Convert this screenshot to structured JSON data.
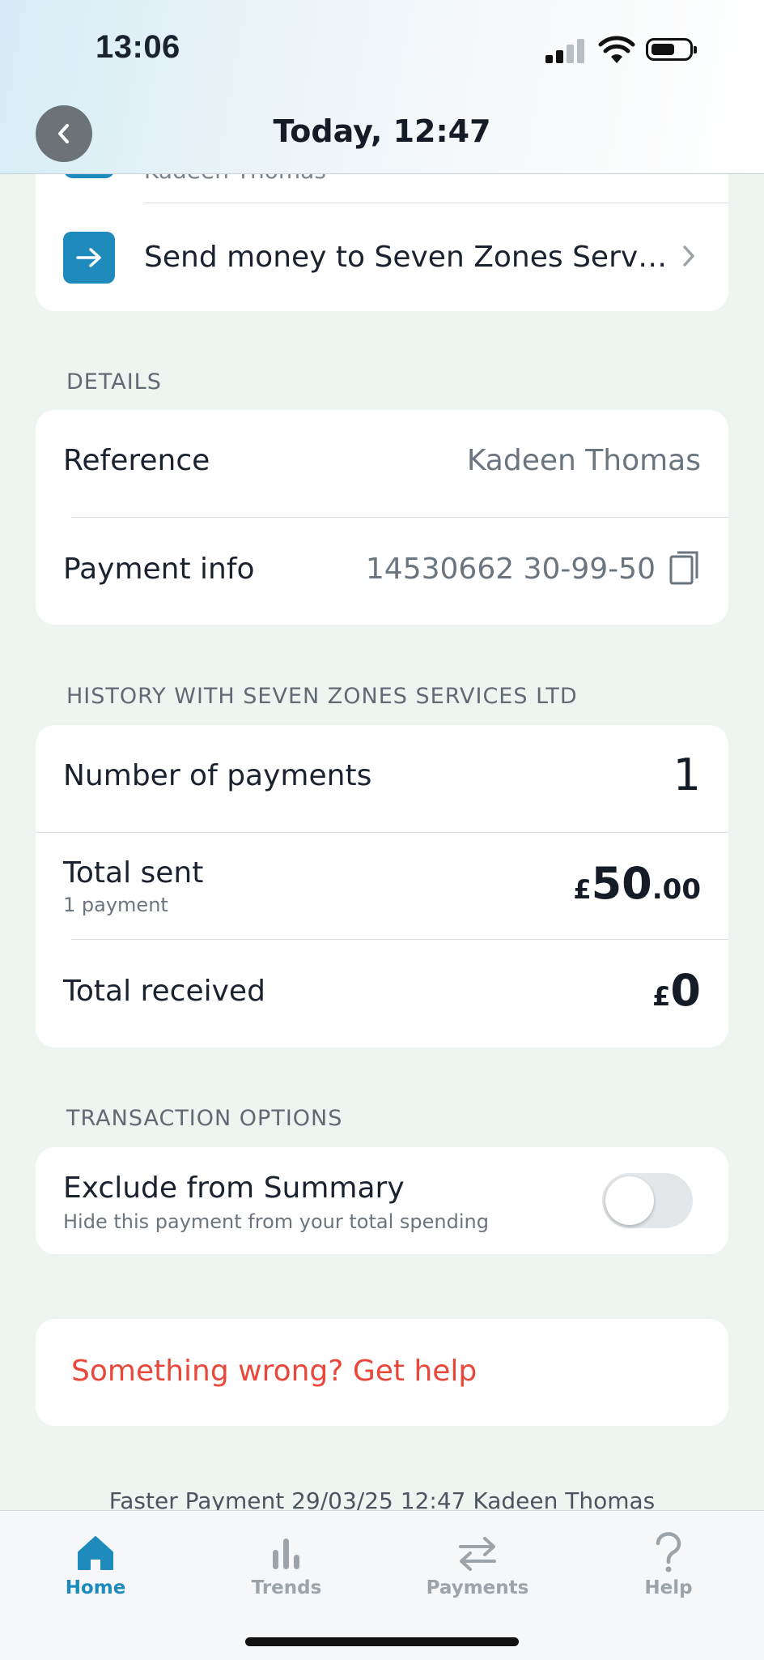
{
  "status_bar": {
    "time": "13:06"
  },
  "header": {
    "title": "Today, 12:47"
  },
  "top_card": {
    "partial_name": "Kadeen Thomas",
    "send_money_label": "Send money to Seven Zones Serv…"
  },
  "details": {
    "section_title": "DETAILS",
    "reference_label": "Reference",
    "reference_value": "Kadeen Thomas",
    "payment_info_label": "Payment info",
    "payment_info_value": "14530662 30-99-50"
  },
  "history": {
    "section_title": "HISTORY WITH SEVEN ZONES SERVICES LTD",
    "num_payments_label": "Number of payments",
    "num_payments_value": "1",
    "total_sent_label": "Total sent",
    "total_sent_sub": "1 payment",
    "total_sent_currency": "£",
    "total_sent_whole": "50",
    "total_sent_decimal": ".00",
    "total_received_label": "Total received",
    "total_received_currency": "£",
    "total_received_whole": "0"
  },
  "options": {
    "section_title": "TRANSACTION OPTIONS",
    "exclude_label": "Exclude from Summary",
    "exclude_sub": "Hide this payment from your total spending",
    "exclude_enabled": false
  },
  "help": {
    "label": "Something wrong? Get help",
    "color": "#e8473a"
  },
  "footer": {
    "text": "Faster Payment 29/03/25 12:47 Kadeen Thomas"
  },
  "tabbar": {
    "tabs": [
      {
        "label": "Home",
        "icon": "home-icon",
        "active": true
      },
      {
        "label": "Trends",
        "icon": "bar-chart-icon",
        "active": false
      },
      {
        "label": "Payments",
        "icon": "transfer-arrows-icon",
        "active": false
      },
      {
        "label": "Help",
        "icon": "question-mark-icon",
        "active": false
      }
    ]
  },
  "colors": {
    "accent": "#1f8bbd",
    "background": "#eef5f1",
    "danger": "#e8473a"
  }
}
